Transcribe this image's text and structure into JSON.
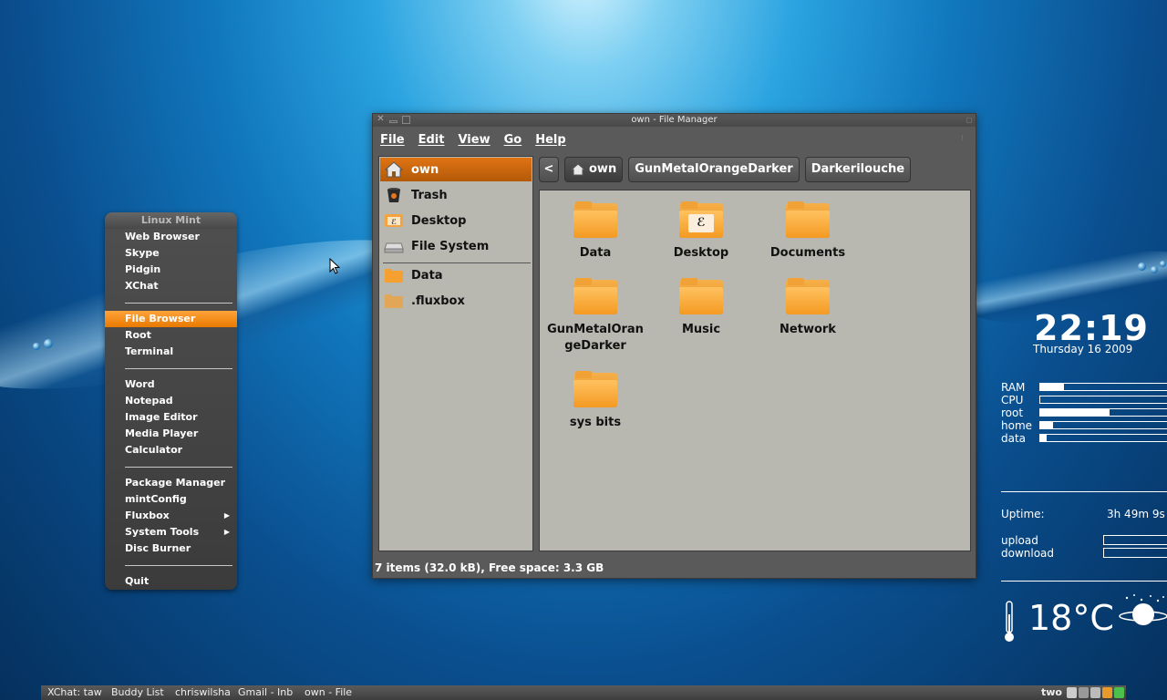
{
  "menu": {
    "title": "Linux Mint",
    "items": [
      {
        "label": "Web Browser"
      },
      {
        "label": "Skype"
      },
      {
        "label": "Pidgin"
      },
      {
        "label": "XChat"
      },
      {
        "label": "File Browser"
      },
      {
        "label": "Root"
      },
      {
        "label": "Terminal"
      },
      {
        "label": "Word"
      },
      {
        "label": "Notepad"
      },
      {
        "label": "Image Editor"
      },
      {
        "label": "Media Player"
      },
      {
        "label": "Calculator"
      },
      {
        "label": "Package Manager"
      },
      {
        "label": "mintConfig"
      },
      {
        "label": "Fluxbox"
      },
      {
        "label": "System Tools"
      },
      {
        "label": "Disc Burner"
      },
      {
        "label": "Quit"
      }
    ],
    "active_item": "File Browser",
    "submenu_arrow": "▶"
  },
  "file_manager": {
    "title": "own - File Manager",
    "menubar": [
      "File",
      "Edit",
      "View",
      "Go",
      "Help"
    ],
    "sidebar": [
      {
        "label": "own",
        "icon": "home-icon"
      },
      {
        "label": "Trash",
        "icon": "trash-icon"
      },
      {
        "label": "Desktop",
        "icon": "desktop-icon"
      },
      {
        "label": "File System",
        "icon": "drive-icon"
      },
      {
        "label": "Data",
        "icon": "folder-icon"
      },
      {
        "label": ".fluxbox",
        "icon": "folder-icon"
      }
    ],
    "pathbar": {
      "back": "<",
      "items": [
        "own",
        "GunMetalOrangeDarker",
        "Darkerilouche"
      ]
    },
    "files": [
      {
        "label": "Data"
      },
      {
        "label": "Desktop"
      },
      {
        "label": "Documents"
      },
      {
        "label": "GunMetalOrangeDarker"
      },
      {
        "label": "Music"
      },
      {
        "label": "Network"
      },
      {
        "label": "sys bits"
      }
    ],
    "status": "7 items (32.0 kB), Free space: 3.3 GB"
  },
  "conky": {
    "time": "22:19",
    "date": "Thursday 16 2009",
    "stats": [
      {
        "label": "RAM",
        "level": 0.19
      },
      {
        "label": "CPU",
        "level": 0.0
      },
      {
        "label": "root",
        "level": 0.55
      },
      {
        "label": "home",
        "level": 0.1
      },
      {
        "label": "data",
        "level": 0.05
      }
    ],
    "uptime_label": "Uptime:",
    "uptime_value": "3h 49m 9s",
    "upload_label": "upload",
    "download_label": "download",
    "temperature": "18°C"
  },
  "taskbar": {
    "tasks": [
      "XChat: taw",
      "Buddy List",
      "chriswilsha",
      "Gmail - Inb",
      "own - File"
    ],
    "workspace": "two"
  }
}
